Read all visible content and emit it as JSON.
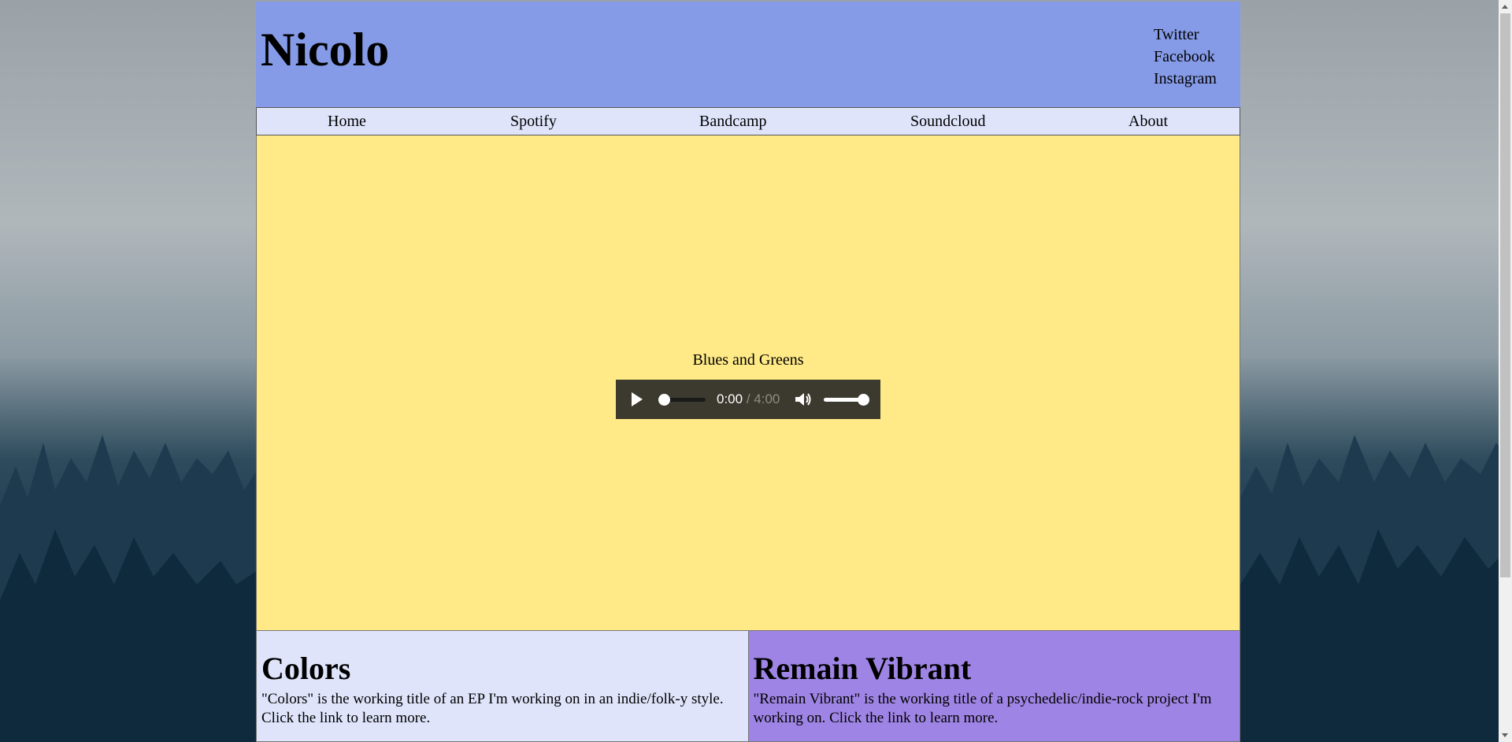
{
  "header": {
    "site_title": "Nicolo",
    "social_links": [
      "Twitter",
      "Facebook",
      "Instagram"
    ]
  },
  "nav": {
    "items": [
      "Home",
      "Spotify",
      "Bandcamp",
      "Soundcloud",
      "About"
    ]
  },
  "player": {
    "track_title": "Blues and Greens",
    "current_time": "0:00",
    "duration": "/ 4:00",
    "progress": 0,
    "volume": 1
  },
  "cards": [
    {
      "title": "Colors",
      "description": "\"Colors\" is the working title of an EP I'm working on in an indie/folk-y style. Click the link to learn more."
    },
    {
      "title": "Remain Vibrant",
      "description": "\"Remain Vibrant\" is the working title of a psychedelic/indie-rock project I'm working on. Click the link to learn more."
    }
  ],
  "colors": {
    "header_bg": "#869be7",
    "nav_bg": "#dfe4fa",
    "main_bg": "#ffea87",
    "card_left_bg": "#dfe4fa",
    "card_right_bg": "#9e84e4"
  }
}
